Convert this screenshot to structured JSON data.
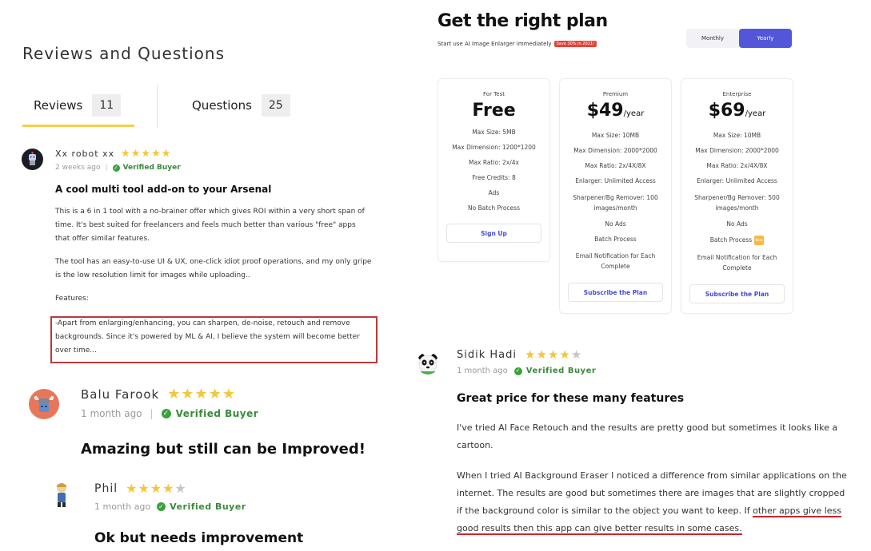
{
  "reviews_section": {
    "title": "Reviews and Questions",
    "tabs": [
      {
        "label": "Reviews",
        "count": "11"
      },
      {
        "label": "Questions",
        "count": "25"
      }
    ]
  },
  "reviews": [
    {
      "name": "Xx robot xx",
      "rating": 5,
      "time": "2 weeks ago",
      "verified": "Verified Buyer",
      "title": "A cool multi tool add-on to your Arsenal",
      "paragraphs": [
        "This is a 6 in 1 tool with a no-brainer offer which gives ROI within a very short span of time. It's best suited for freelancers and feels much better than various \"free\" apps that offer similar features.",
        "The tool has an easy-to-use UI & UX, one-click idiot proof operations, and my only gripe is the low resolution limit for images while uploading..",
        "Features:",
        "-Apart from enlarging/enhancing, you can sharpen, de-noise, retouch and remove backgrounds. Since it's powered by ML & AI, I believe the system will become better over time..."
      ]
    },
    {
      "name": "Balu Farook",
      "rating": 5,
      "time": "1 month ago",
      "verified": "Verified Buyer",
      "title": "Amazing but still can be Improved!"
    },
    {
      "name": "Phil",
      "rating": 4,
      "time": "1 month ago",
      "verified": "Verified Buyer",
      "title": "Ok but needs improvement"
    },
    {
      "name": "Sidik Hadi",
      "rating": 4,
      "time": "1 month ago",
      "verified": "Verified Buyer",
      "title": "Great price for these many features",
      "paragraphs": [
        "I've tried AI Face Retouch and the results are pretty good but sometimes it looks like a cartoon.",
        "When I tried AI Background Eraser I noticed a difference from similar applications on the internet. The results are good but sometimes there are images that are slightly cropped if the background color is similar to the object you want to keep. If",
        "other apps give less good results then this app can give better results in some cases."
      ]
    }
  ],
  "pricing": {
    "title": "Get the right plan",
    "subtitle": "Start use AI Image Enlarger immediately",
    "badge": "Save 30% in 2021!",
    "toggle": {
      "monthly": "Monthly",
      "yearly": "Yearly",
      "active": "yearly"
    },
    "plans": [
      {
        "tier": "For Test",
        "price": "Free",
        "per": "",
        "features": [
          "Max Size: 5MB",
          "Max Dimension: 1200*1200",
          "Max Ratio: 2x/4x",
          "Free Credits: 8",
          "Ads",
          "No Batch Process"
        ],
        "cta": "Sign Up"
      },
      {
        "tier": "Premium",
        "price": "$49",
        "per": "/year",
        "features": [
          "Max Size: 10MB",
          "Max Dimension: 2000*2000",
          "Max Ratio: 2x/4X/8X",
          "Enlarger: Unlimited Access",
          "Sharpener/Bg Remover: 100 images/month",
          "No Ads",
          "Batch Process",
          "Email Notification for Each Complete"
        ],
        "cta": "Subscribe the Plan"
      },
      {
        "tier": "Enterprise",
        "price": "$69",
        "per": "/year",
        "features": [
          "Max Size: 10MB",
          "Max Dimension: 2000*2000",
          "Max Ratio: 2x/4X/8X",
          "Enlarger: Unlimited Access",
          "Sharpener/Bg Remover: 500 images/month",
          "No Ads",
          "Batch Process",
          "Email Notification for Each Complete"
        ],
        "new_badge": "New",
        "cta": "Subscribe the Plan"
      }
    ]
  },
  "colors": {
    "accent": "#5356d9",
    "star": "#f5c63a",
    "verified": "#3a8a3a",
    "tab_underline": "#f2cf4a",
    "highlight": "#b93a3a"
  }
}
